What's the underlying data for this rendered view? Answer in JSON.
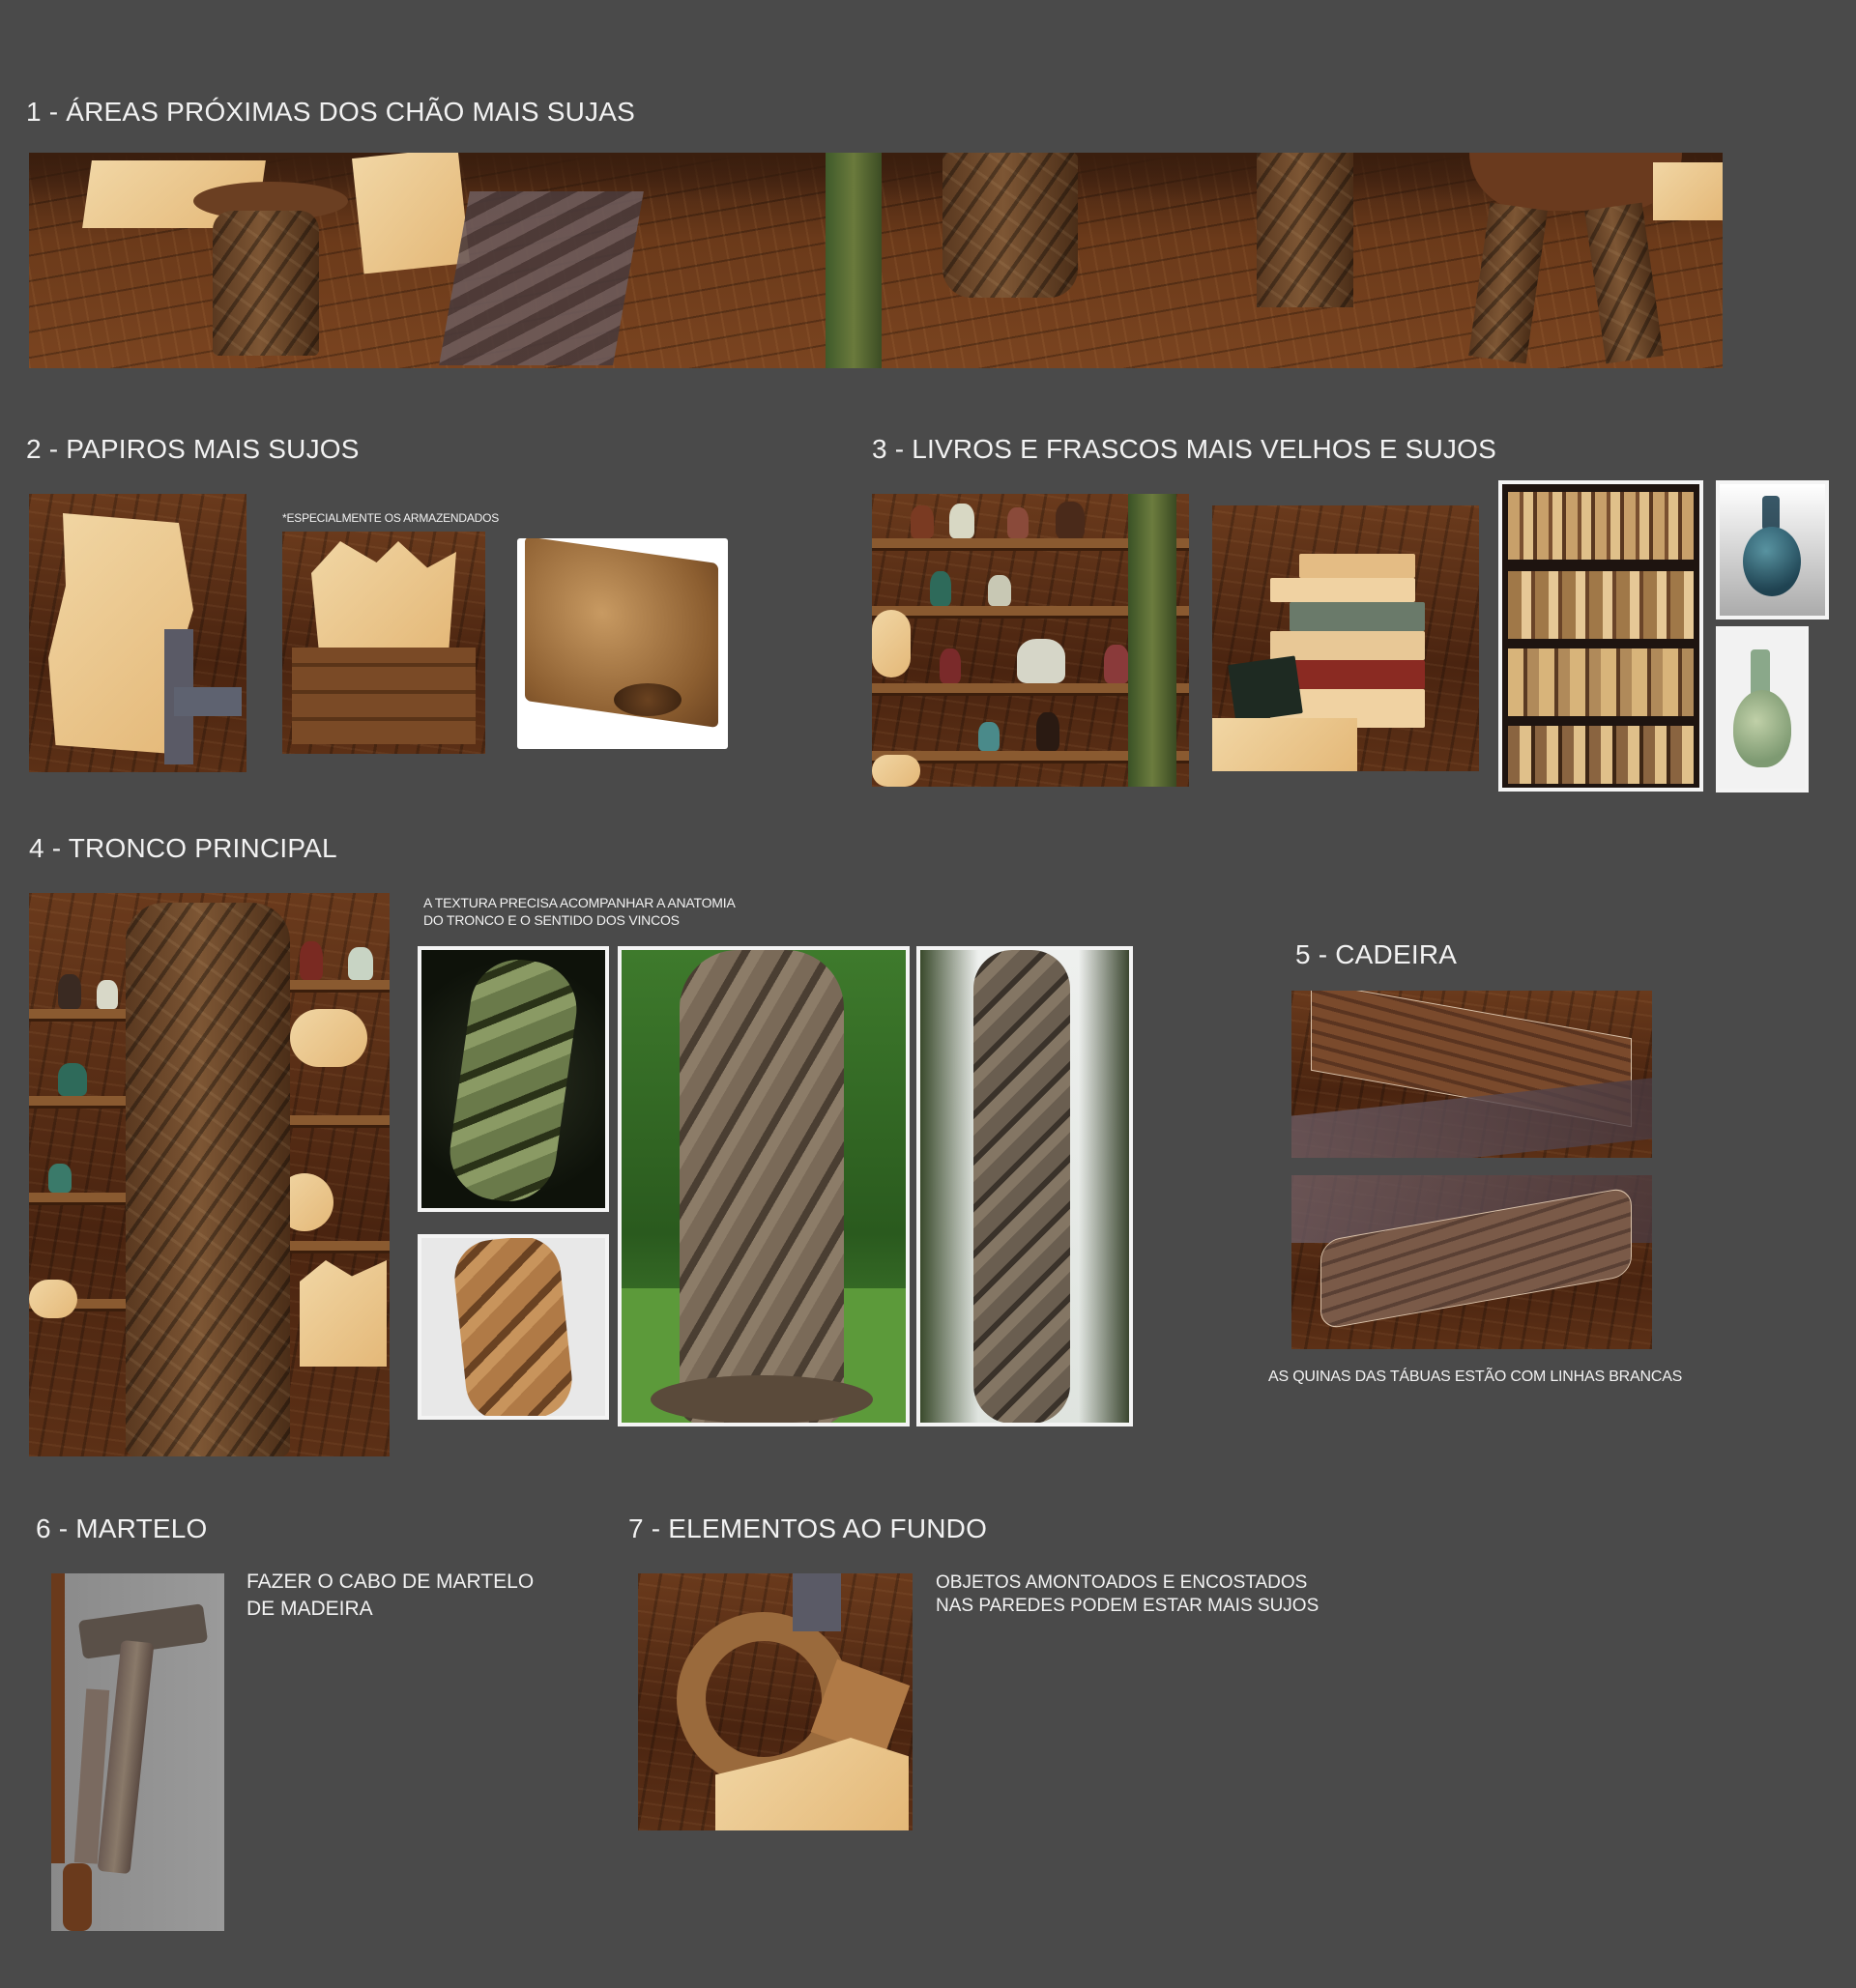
{
  "sections": {
    "s1": {
      "title": "1 - ÁREAS PRÓXIMAS DOS CHÃO MAIS SUJAS"
    },
    "s2": {
      "title": "2 - PAPIROS MAIS SUJOS",
      "note": "*ESPECIALMENTE OS ARMAZENDADOS"
    },
    "s3": {
      "title": "3 - LIVROS E FRASCOS MAIS VELHOS E SUJOS"
    },
    "s4": {
      "title": "4 - TRONCO PRINCIPAL",
      "note_line1": "A TEXTURA PRECISA ACOMPANHAR A ANATOMIA",
      "note_line2": "DO TRONCO E O SENTIDO DOS VINCOS"
    },
    "s5": {
      "title": "5 - CADEIRA",
      "note": "AS QUINAS DAS TÁBUAS ESTÃO COM LINHAS BRANCAS"
    },
    "s6": {
      "title": "6 - MARTELO",
      "note_line1": "FAZER O CABO DE MARTELO",
      "note_line2": "DE MADEIRA"
    },
    "s7": {
      "title": "7 - ELEMENTOS AO FUNDO",
      "note_line1": "OBJETOS AMONTOADOS E ENCOSTADOS",
      "note_line2": "NAS PAREDES PODEM ESTAR MAIS SUJOS"
    }
  },
  "colors": {
    "background": "#4a4a4a",
    "text": "#f2f2f2",
    "frame": "#f4f4f4"
  }
}
